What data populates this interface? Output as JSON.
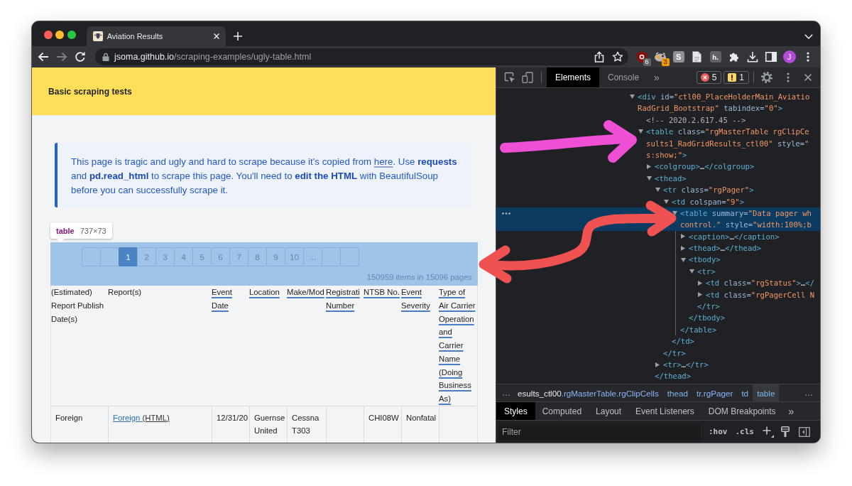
{
  "browser": {
    "tab": {
      "title": "Aviation Results"
    },
    "url": {
      "host": "jsoma.github.io",
      "path": "/scraping-examples/ugly-table.html"
    },
    "extensions": [
      {
        "kind": "shield",
        "badge": "6",
        "color": "#5f6368"
      },
      {
        "kind": "mascot",
        "badge": "3",
        "color": "#f29900"
      },
      {
        "kind": "letter_tile",
        "letter": "S"
      },
      {
        "kind": "document"
      },
      {
        "kind": "speech_tile",
        "letter": "h."
      }
    ],
    "profile": {
      "initial": "J"
    }
  },
  "page": {
    "header": {
      "title": "Basic scraping tests"
    },
    "callout": {
      "before_link": "This page is tragic and ugly and hard to scrape because it's copied from ",
      "link": "here",
      "after_link": ". Use **requests** and **pd.read_html** to scrape this page. You'll need to **edit the HTML** with BeautifulSoup before you can successfully scrape it."
    },
    "inspect_tooltip": {
      "tag": "table",
      "size": "737×73"
    },
    "pager": {
      "buttons": [
        {
          "kind": "blank",
          "selected": false
        },
        {
          "kind": "blank",
          "selected": false
        },
        {
          "kind": "page",
          "label": "1",
          "selected": true
        },
        {
          "kind": "page",
          "label": "2",
          "selected": false
        },
        {
          "kind": "page",
          "label": "3",
          "selected": false
        },
        {
          "kind": "page",
          "label": "4",
          "selected": false
        },
        {
          "kind": "page",
          "label": "5",
          "selected": false
        },
        {
          "kind": "page",
          "label": "6",
          "selected": false
        },
        {
          "kind": "page",
          "label": "7",
          "selected": false
        },
        {
          "kind": "page",
          "label": "8",
          "selected": false
        },
        {
          "kind": "page",
          "label": "9",
          "selected": false
        },
        {
          "kind": "page",
          "label": "10",
          "selected": false
        },
        {
          "kind": "page",
          "label": "...",
          "selected": false
        },
        {
          "kind": "blank",
          "selected": false
        },
        {
          "kind": "blank",
          "selected": false
        }
      ],
      "status": "150959 items in 15096 pages"
    },
    "table": {
      "columns": [
        {
          "label": "(Estimated) Report Publish Date(s)",
          "linked": false
        },
        {
          "label": "Report(s)",
          "linked": false
        },
        {
          "label": "Event Date",
          "linked": true
        },
        {
          "label": "Location",
          "linked": true
        },
        {
          "label": "Make/Mod",
          "linked": true
        },
        {
          "label": "Registrati Number",
          "linked": true
        },
        {
          "label": "NTSB No.",
          "linked": true
        },
        {
          "label": "Event Severity",
          "linked": true
        },
        {
          "label": "Type of Air Carrier Operation and Carrier Name (Doing Business As)",
          "linked": true
        }
      ],
      "rows": [
        {
          "cells": [
            {
              "kind": "text",
              "text": "Foreign"
            },
            {
              "kind": "report_link",
              "text": "Foreign",
              "format": "(HTML)"
            },
            {
              "kind": "text",
              "text": "12/31/20"
            },
            {
              "kind": "text",
              "text": "Guernse United"
            },
            {
              "kind": "text",
              "text": "Cessna T303"
            },
            {
              "kind": "empty"
            },
            {
              "kind": "text",
              "text": "CHI08W"
            },
            {
              "kind": "text",
              "text": "Nonfatal"
            },
            {
              "kind": "empty"
            }
          ]
        }
      ]
    }
  },
  "devtools": {
    "tabs": [
      {
        "label": "Elements",
        "selected": true
      },
      {
        "label": "Console",
        "selected": false
      }
    ],
    "more_tabs": "»",
    "issues": {
      "errors": "5",
      "warnings": "1"
    },
    "dom_tree": [
      {
        "expanded": true,
        "selected": false,
        "lines": [
          [
            {
              "kind": "tag",
              "text": "<div"
            },
            {
              "kind": "attr",
              "text": " id="
            },
            {
              "kind": "value",
              "text": "\"ctl00_PlaceHolderMain_Aviatio"
            }
          ],
          [
            {
              "kind": "value",
              "text": "RadGrid_Bootstrap\""
            },
            {
              "kind": "attr",
              "text": " tabindex="
            },
            {
              "kind": "value",
              "text": "\"0\""
            },
            {
              "kind": "tag",
              "text": ">"
            }
          ]
        ],
        "children": [
          {
            "selected": false,
            "lines": [
              [
                {
                  "kind": "comment",
                  "text": "<!-- 2020.2.617.45 -->"
                }
              ]
            ]
          },
          {
            "expanded": true,
            "selected": false,
            "lines": [
              [
                {
                  "kind": "tag",
                  "text": "<table"
                },
                {
                  "kind": "attr",
                  "text": " class="
                },
                {
                  "kind": "value",
                  "text": "\"rgMasterTable rgClipCe"
                }
              ],
              [
                {
                  "kind": "value",
                  "text": "sults1_RadGridResults_ctl00\""
                },
                {
                  "kind": "attr",
                  "text": " style="
                },
                {
                  "kind": "value",
                  "text": "\""
                }
              ],
              [
                {
                  "kind": "value",
                  "text": "s:show;\""
                },
                {
                  "kind": "tag",
                  "text": ">"
                }
              ]
            ],
            "children": [
              {
                "expanded": false,
                "selected": false,
                "lines": [
                  [
                    {
                      "kind": "tag",
                      "text": "<colgroup>"
                    },
                    {
                      "kind": "text",
                      "text": "…"
                    },
                    {
                      "kind": "tag",
                      "text": "</colgroup>"
                    }
                  ]
                ]
              },
              {
                "expanded": true,
                "selected": false,
                "lines": [
                  [
                    {
                      "kind": "tag",
                      "text": "<thead>"
                    }
                  ]
                ],
                "closing": [
                  {
                    "kind": "tag",
                    "text": "</thead>"
                  }
                ],
                "children": [
                  {
                    "expanded": true,
                    "selected": false,
                    "lines": [
                      [
                        {
                          "kind": "tag",
                          "text": "<tr"
                        },
                        {
                          "kind": "attr",
                          "text": " class="
                        },
                        {
                          "kind": "value",
                          "text": "\"rgPager\""
                        },
                        {
                          "kind": "tag",
                          "text": ">"
                        }
                      ]
                    ],
                    "closing": [
                      {
                        "kind": "tag",
                        "text": "</tr>"
                      }
                    ],
                    "children": [
                      {
                        "expanded": true,
                        "selected": false,
                        "lines": [
                          [
                            {
                              "kind": "tag",
                              "text": "<td"
                            },
                            {
                              "kind": "attr",
                              "text": " colspan="
                            },
                            {
                              "kind": "value",
                              "text": "\"9\""
                            },
                            {
                              "kind": "tag",
                              "text": ">"
                            }
                          ]
                        ],
                        "closing": [
                          {
                            "kind": "tag",
                            "text": "</td>"
                          }
                        ],
                        "children": [
                          {
                            "expanded": true,
                            "selected": true,
                            "lines": [
                              [
                                {
                                  "kind": "tag",
                                  "text": "<table"
                                },
                                {
                                  "kind": "attr",
                                  "text": " summary="
                                },
                                {
                                  "kind": "value",
                                  "text": "\"Data pager wh"
                                }
                              ],
                              [
                                {
                                  "kind": "value",
                                  "text": "control.\""
                                },
                                {
                                  "kind": "attr",
                                  "text": " style="
                                },
                                {
                                  "kind": "value",
                                  "text": "\"width:100%;b"
                                }
                              ]
                            ],
                            "closing": [
                              {
                                "kind": "tag",
                                "text": "</table>"
                              }
                            ],
                            "children": [
                              {
                                "expanded": false,
                                "selected": false,
                                "lines": [
                                  [
                                    {
                                      "kind": "tag",
                                      "text": "<caption>"
                                    },
                                    {
                                      "kind": "text",
                                      "text": "…"
                                    },
                                    {
                                      "kind": "tag",
                                      "text": "</caption>"
                                    }
                                  ]
                                ]
                              },
                              {
                                "expanded": false,
                                "selected": false,
                                "lines": [
                                  [
                                    {
                                      "kind": "tag",
                                      "text": "<thead>"
                                    },
                                    {
                                      "kind": "text",
                                      "text": "…"
                                    },
                                    {
                                      "kind": "tag",
                                      "text": "</thead>"
                                    }
                                  ]
                                ]
                              },
                              {
                                "expanded": true,
                                "selected": false,
                                "lines": [
                                  [
                                    {
                                      "kind": "tag",
                                      "text": "<tbody>"
                                    }
                                  ]
                                ],
                                "closing": [
                                  {
                                    "kind": "tag",
                                    "text": "</tbody>"
                                  }
                                ],
                                "children": [
                                  {
                                    "expanded": true,
                                    "selected": false,
                                    "lines": [
                                      [
                                        {
                                          "kind": "tag",
                                          "text": "<tr>"
                                        }
                                      ]
                                    ],
                                    "closing": [
                                      {
                                        "kind": "tag",
                                        "text": "</tr>"
                                      }
                                    ],
                                    "children": [
                                      {
                                        "expanded": false,
                                        "selected": false,
                                        "lines": [
                                          [
                                            {
                                              "kind": "tag",
                                              "text": "<td"
                                            },
                                            {
                                              "kind": "attr",
                                              "text": " class="
                                            },
                                            {
                                              "kind": "value",
                                              "text": "\"rgStatus\""
                                            },
                                            {
                                              "kind": "tag",
                                              "text": ">"
                                            },
                                            {
                                              "kind": "text",
                                              "text": "…"
                                            },
                                            {
                                              "kind": "tag",
                                              "text": "</"
                                            }
                                          ]
                                        ]
                                      },
                                      {
                                        "expanded": false,
                                        "selected": false,
                                        "lines": [
                                          [
                                            {
                                              "kind": "tag",
                                              "text": "<td"
                                            },
                                            {
                                              "kind": "attr",
                                              "text": " class="
                                            },
                                            {
                                              "kind": "value",
                                              "text": "\"rgPagerCell N"
                                            }
                                          ]
                                        ]
                                      }
                                    ]
                                  }
                                ]
                              }
                            ]
                          }
                        ]
                      }
                    ]
                  },
                  {
                    "expanded": false,
                    "selected": false,
                    "lines": [
                      [
                        {
                          "kind": "tag",
                          "text": "<tr>"
                        },
                        {
                          "kind": "text",
                          "text": "…"
                        },
                        {
                          "kind": "tag",
                          "text": "</tr>"
                        }
                      ]
                    ]
                  }
                ]
              }
            ]
          }
        ]
      }
    ],
    "breadcrumbs": {
      "scroll_left": "…",
      "items": [
        {
          "parts": [
            {
              "kind": "id",
              "text": "esults_ctl00"
            },
            {
              "kind": "class",
              "text": ".rgMasterTable.rgClipCells"
            }
          ],
          "selected": false
        },
        {
          "parts": [
            {
              "kind": "tag",
              "text": "thead"
            }
          ],
          "selected": false
        },
        {
          "parts": [
            {
              "kind": "tag",
              "text": "tr"
            },
            {
              "kind": "class",
              "text": ".rgPager"
            }
          ],
          "selected": false
        },
        {
          "parts": [
            {
              "kind": "tag",
              "text": "td"
            }
          ],
          "selected": false
        },
        {
          "parts": [
            {
              "kind": "tag",
              "text": "table"
            }
          ],
          "selected": true
        }
      ],
      "scroll_right": "…"
    },
    "sidebar_tabs": [
      {
        "label": "Styles",
        "selected": true
      },
      {
        "label": "Computed",
        "selected": false
      },
      {
        "label": "Layout",
        "selected": false
      },
      {
        "label": "Event Listeners",
        "selected": false
      },
      {
        "label": "DOM Breakpoints",
        "selected": false
      }
    ],
    "more_sidebar_tabs": "»",
    "filter": {
      "placeholder": "Filter"
    },
    "filter_toggles": [
      ":hov",
      ".cls"
    ]
  }
}
